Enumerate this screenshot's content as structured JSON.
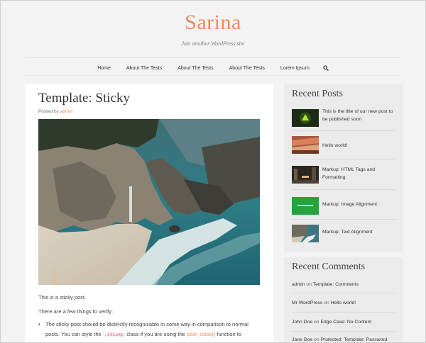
{
  "site": {
    "title": "Sarina",
    "tagline": "Just another WordPress site"
  },
  "nav": {
    "items": [
      "Home",
      "About The Tests",
      "About The Tests",
      "About The Tests",
      "Lorem Ipsum"
    ],
    "search_icon": "search-icon"
  },
  "post": {
    "title": "Template: Sticky",
    "posted_by_label": "Posted by",
    "author": "admin",
    "image_alt": "beach-waterfall-photo",
    "para1": "This is a sticky post.",
    "para2": "There are a few things to verify:",
    "bullet": "•",
    "list_part1": "The sticky post should be distinctly recognizable in some way in comparison to normal posts. You can style the ",
    "list_code": ".sticky",
    "list_part2": " class if you are using the ",
    "list_link": "post_class()",
    "list_part3": " function to generate your post classes, which is a best practice."
  },
  "sidebar": {
    "recent_posts_title": "Recent Posts",
    "recent_posts": [
      "This is the title of our new post to be published soon",
      "Hello world!",
      "Markup: HTML Tags and Formatting",
      "Markup: Image Alignment",
      "Markup: Text Alignment"
    ],
    "recent_comments_title": "Recent Comments",
    "recent_comments": [
      {
        "author": "admin",
        "on": "on",
        "post": "Template: Comments"
      },
      {
        "author": "Mr WordPress",
        "on": "on",
        "post": "Hello world!"
      },
      {
        "author": "John Doe",
        "on": "on",
        "post": "Edge Case: No Content"
      },
      {
        "author": "Jane Doe",
        "on": "on",
        "post": "Protected: Template: Password"
      }
    ]
  },
  "colors": {
    "accent": "#f18a5e",
    "background": "#f3f3f3",
    "widget_bg": "#ebebeb"
  }
}
